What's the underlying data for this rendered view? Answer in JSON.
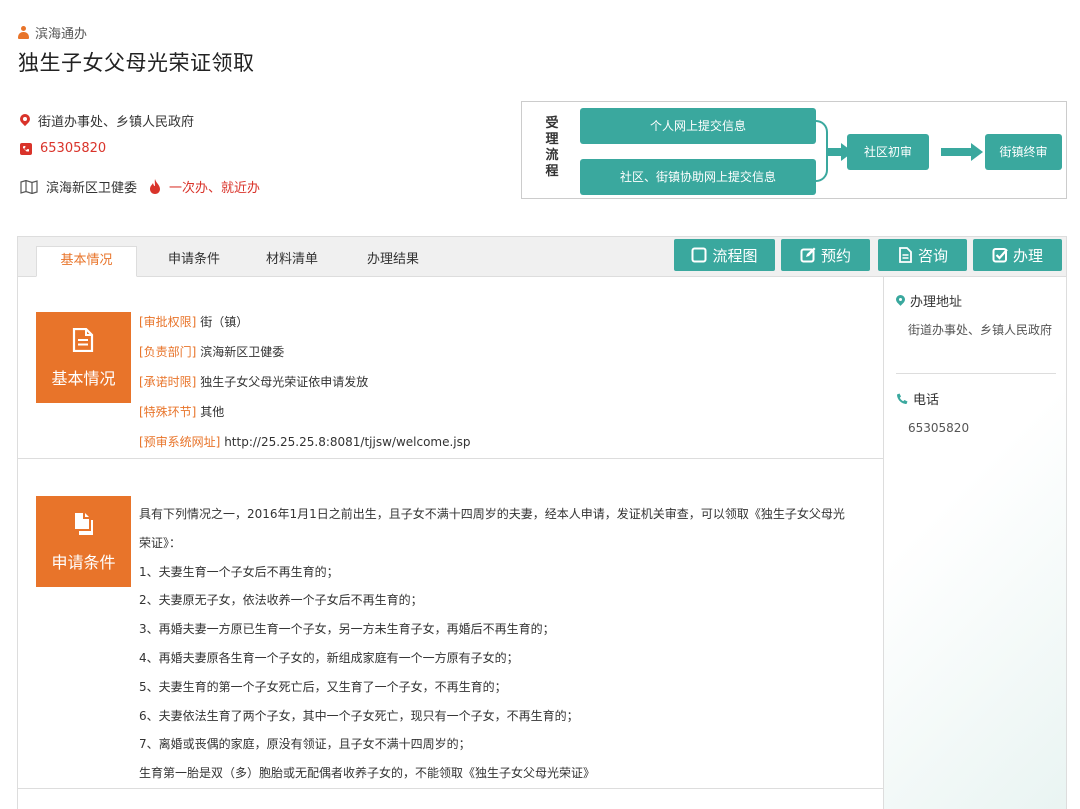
{
  "header": {
    "brand": "滨海通办",
    "title": "独生子女父母光荣证领取"
  },
  "info": {
    "location": "街道办事处、乡镇人民政府",
    "phone": "65305820",
    "department": "滨海新区卫健委",
    "tag": "一次办、就近办"
  },
  "flow": {
    "label": "受理流程",
    "steps": [
      "个人网上提交信息",
      "社区、街镇协助网上提交信息",
      "社区初审",
      "街镇终审"
    ]
  },
  "tabs": [
    "基本情况",
    "申请条件",
    "材料清单",
    "办理结果"
  ],
  "actions": [
    "流程图",
    "预约",
    "咨询",
    "办理"
  ],
  "basic": {
    "badge": "基本情况",
    "items": [
      {
        "k": "[审批权限]",
        "v": " 街（镇）"
      },
      {
        "k": "[负责部门]",
        "v": " 滨海新区卫健委"
      },
      {
        "k": "[承诺时限]",
        "v": " 独生子女父母光荣证依申请发放"
      },
      {
        "k": "[特殊环节]",
        "v": " 其他"
      },
      {
        "k": "[预审系统网址]",
        "v": " http://25.25.25.8:8081/tjjsw/welcome.jsp"
      }
    ]
  },
  "conditions": {
    "badge": "申请条件",
    "lines": [
      "具有下列情况之一，2016年1月1日之前出生，且子女不满十四周岁的夫妻，经本人申请，发证机关审查，可以领取《独生子女父母光",
      "荣证》：",
      "1、夫妻生育一个子女后不再生育的；",
      "2、夫妻原无子女，依法收养一个子女后不再生育的；",
      "3、再婚夫妻一方原已生育一个子女，另一方未生育子女，再婚后不再生育的；",
      "4、再婚夫妻原各生育一个子女的，新组成家庭有一个一方原有子女的；",
      "5、夫妻生育的第一个子女死亡后，又生育了一个子女，不再生育的；",
      "6、夫妻依法生育了两个子女，其中一个子女死亡，现只有一个子女，不再生育的；",
      "7、离婚或丧偶的家庭，原没有领证，且子女不满十四周岁的；",
      "生育第一胎是双（多）胞胎或无配偶者收养子女的，不能领取《独生子女父母光荣证》"
    ]
  },
  "side": {
    "address_title": "办理地址",
    "address": "街道办事处、乡镇人民政府",
    "phone_title": "电话",
    "phone": "65305820"
  },
  "colors": {
    "accent_orange": "#e8742a",
    "teal": "#3aa89e",
    "red": "#d9332a"
  }
}
